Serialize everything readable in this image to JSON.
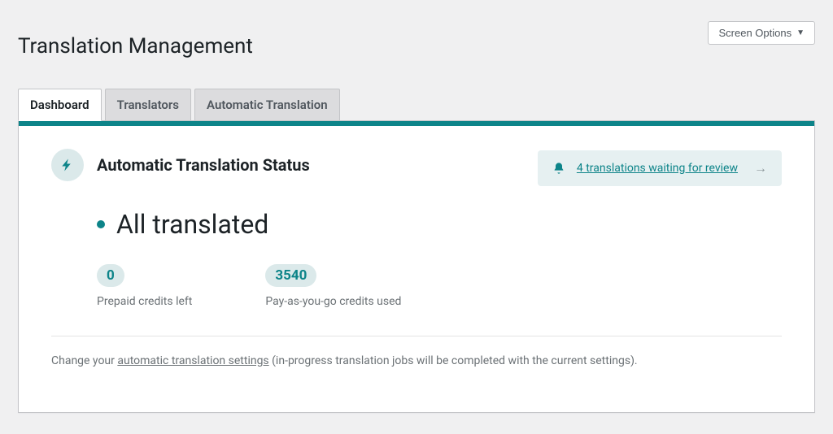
{
  "header": {
    "screen_options": "Screen Options",
    "page_title": "Translation Management"
  },
  "tabs": [
    {
      "label": "Dashboard",
      "active": true
    },
    {
      "label": "Translators",
      "active": false
    },
    {
      "label": "Automatic Translation",
      "active": false
    }
  ],
  "status_card": {
    "title": "Automatic Translation Status",
    "review_notice": "4 translations waiting for review",
    "status_text": "All translated",
    "metrics": {
      "prepaid": {
        "value": "0",
        "label": "Prepaid credits left"
      },
      "payg": {
        "value": "3540",
        "label": "Pay-as-you-go credits used"
      }
    },
    "footer_prefix": "Change your ",
    "footer_link": "automatic translation settings",
    "footer_suffix": " (in-progress translation jobs will be completed with the current settings)."
  },
  "colors": {
    "accent": "#0d8489",
    "accent_bg": "#dbe9ea"
  }
}
